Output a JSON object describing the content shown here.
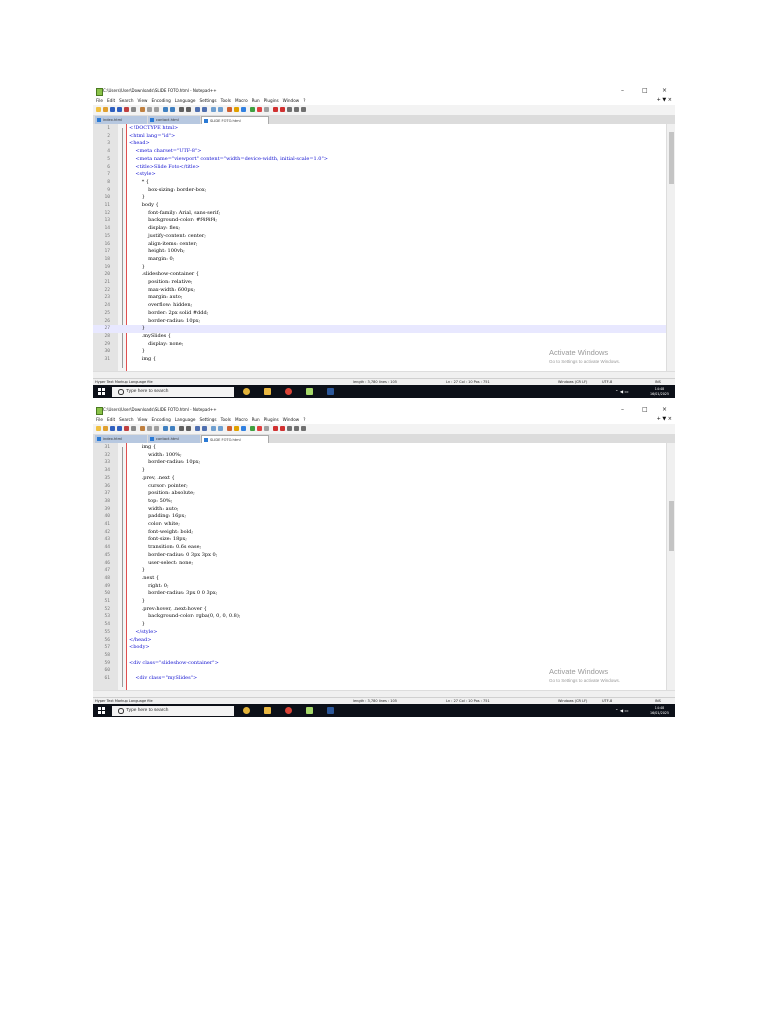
{
  "window": {
    "title": "C:\\Users\\User\\Downloads\\SLIDE FOTO.html - Notepad++",
    "controls": {
      "minimize": "–",
      "maximize": "□",
      "close": "×"
    }
  },
  "menu": [
    "File",
    "Edit",
    "Search",
    "View",
    "Encoding",
    "Language",
    "Settings",
    "Tools",
    "Macro",
    "Run",
    "Plugins",
    "Window",
    "?"
  ],
  "menu_right": "+ ▼ ×",
  "tabs": [
    {
      "label": "index.html",
      "active": false
    },
    {
      "label": "contact.html",
      "active": false
    },
    {
      "label": "SLIDE FOTO.html",
      "active": true
    }
  ],
  "colors": {
    "tag": "#1010d0",
    "text": "#000000",
    "current_line": "#e8e8ff",
    "taskbar": "#0c1018"
  },
  "shot1": {
    "lines": [
      {
        "n": "1",
        "t": "<!DOCTYPE html>",
        "c": "tag"
      },
      {
        "n": "2",
        "t": "<html lang=\"id\">",
        "c": "tag"
      },
      {
        "n": "3",
        "t": "<head>",
        "c": "tag"
      },
      {
        "n": "4",
        "t": "    <meta charset=\"UTF-8\">",
        "c": "tag"
      },
      {
        "n": "5",
        "t": "    <meta name=\"viewport\" content=\"width=device-width, initial-scale=1.0\">",
        "c": "tag"
      },
      {
        "n": "6",
        "t": "    <title>Slide Foto</title>",
        "c": "tag"
      },
      {
        "n": "7",
        "t": "    <style>",
        "c": "tag"
      },
      {
        "n": "8",
        "t": "        * {",
        "c": "text"
      },
      {
        "n": "9",
        "t": "            box-sizing: border-box;",
        "c": "text"
      },
      {
        "n": "10",
        "t": "        }",
        "c": "text"
      },
      {
        "n": "11",
        "t": "        body {",
        "c": "text"
      },
      {
        "n": "12",
        "t": "            font-family: Arial, sans-serif;",
        "c": "text"
      },
      {
        "n": "13",
        "t": "            background-color: #f4f4f4;",
        "c": "text"
      },
      {
        "n": "14",
        "t": "            display: flex;",
        "c": "text"
      },
      {
        "n": "15",
        "t": "            justify-content: center;",
        "c": "text"
      },
      {
        "n": "16",
        "t": "            align-items: center;",
        "c": "text"
      },
      {
        "n": "17",
        "t": "            height: 100vh;",
        "c": "text"
      },
      {
        "n": "18",
        "t": "            margin: 0;",
        "c": "text"
      },
      {
        "n": "19",
        "t": "        }",
        "c": "text"
      },
      {
        "n": "20",
        "t": "        .slideshow-container {",
        "c": "text"
      },
      {
        "n": "21",
        "t": "            position: relative;",
        "c": "text"
      },
      {
        "n": "22",
        "t": "            max-width: 600px;",
        "c": "text"
      },
      {
        "n": "23",
        "t": "            margin: auto;",
        "c": "text"
      },
      {
        "n": "24",
        "t": "            overflow: hidden;",
        "c": "text"
      },
      {
        "n": "25",
        "t": "            border: 2px solid #ddd;",
        "c": "text"
      },
      {
        "n": "26",
        "t": "            border-radius: 10px;",
        "c": "text"
      },
      {
        "n": "27",
        "t": "        }",
        "c": "text",
        "hl": true
      },
      {
        "n": "28",
        "t": "        .mySlides {",
        "c": "text"
      },
      {
        "n": "29",
        "t": "            display: none;",
        "c": "text"
      },
      {
        "n": "30",
        "t": "        }",
        "c": "text"
      },
      {
        "n": "31",
        "t": "        img {",
        "c": "text"
      }
    ],
    "status": {
      "type": "Hyper Text Markup Language file",
      "length": "length : 3,780   lines : 105",
      "pos": "Ln : 27   Col : 10   Pos : 751",
      "eol": "Windows (CR LF)",
      "enc": "UTF-8",
      "mode": "INS"
    }
  },
  "shot2": {
    "lines": [
      {
        "n": "31",
        "t": "        img {",
        "c": "text"
      },
      {
        "n": "32",
        "t": "            width: 100%;",
        "c": "text"
      },
      {
        "n": "33",
        "t": "            border-radius: 10px;",
        "c": "text"
      },
      {
        "n": "34",
        "t": "        }",
        "c": "text"
      },
      {
        "n": "35",
        "t": "        .prev, .next {",
        "c": "text"
      },
      {
        "n": "36",
        "t": "            cursor: pointer;",
        "c": "text"
      },
      {
        "n": "37",
        "t": "            position: absolute;",
        "c": "text"
      },
      {
        "n": "38",
        "t": "            top: 50%;",
        "c": "text"
      },
      {
        "n": "39",
        "t": "            width: auto;",
        "c": "text"
      },
      {
        "n": "40",
        "t": "            padding: 16px;",
        "c": "text"
      },
      {
        "n": "41",
        "t": "            color: white;",
        "c": "text"
      },
      {
        "n": "42",
        "t": "            font-weight: bold;",
        "c": "text"
      },
      {
        "n": "43",
        "t": "            font-size: 18px;",
        "c": "text"
      },
      {
        "n": "44",
        "t": "            transition: 0.6s ease;",
        "c": "text"
      },
      {
        "n": "45",
        "t": "            border-radius: 0 3px 3px 0;",
        "c": "text"
      },
      {
        "n": "46",
        "t": "            user-select: none;",
        "c": "text"
      },
      {
        "n": "47",
        "t": "        }",
        "c": "text"
      },
      {
        "n": "48",
        "t": "        .next {",
        "c": "text"
      },
      {
        "n": "49",
        "t": "            right: 0;",
        "c": "text"
      },
      {
        "n": "50",
        "t": "            border-radius: 3px 0 0 3px;",
        "c": "text"
      },
      {
        "n": "51",
        "t": "        }",
        "c": "text"
      },
      {
        "n": "52",
        "t": "        .prev:hover, .next:hover {",
        "c": "text"
      },
      {
        "n": "53",
        "t": "            background-color: rgba(0, 0, 0, 0.8);",
        "c": "text"
      },
      {
        "n": "54",
        "t": "        }",
        "c": "text"
      },
      {
        "n": "55",
        "t": "    </style>",
        "c": "tag"
      },
      {
        "n": "56",
        "t": "</head>",
        "c": "tag"
      },
      {
        "n": "57",
        "t": "<body>",
        "c": "tag"
      },
      {
        "n": "58",
        "t": "",
        "c": "text"
      },
      {
        "n": "59",
        "t": "<div class=\"slideshow-container\">",
        "c": "tag"
      },
      {
        "n": "60",
        "t": "",
        "c": "text"
      },
      {
        "n": "61",
        "t": "    <div class=\"mySlides\">",
        "c": "tag"
      }
    ],
    "status": {
      "type": "Hyper Text Markup Language file",
      "length": "length : 3,780   lines : 105",
      "pos": "Ln : 27   Col : 10   Pos : 751",
      "eol": "Windows (CR LF)",
      "enc": "UTF-8",
      "mode": "INS"
    }
  },
  "watermark": {
    "title": "Activate Windows",
    "subtitle": "Go to Settings to activate Windows."
  },
  "taskbar": {
    "search_placeholder": "Type here to search",
    "apps": [
      "chrome-icon",
      "file-explorer-icon",
      "chrome-icon",
      "notepad-plus-plus-icon",
      "word-icon"
    ],
    "clock_time": "14:48",
    "clock_date": "16/01/2025"
  }
}
